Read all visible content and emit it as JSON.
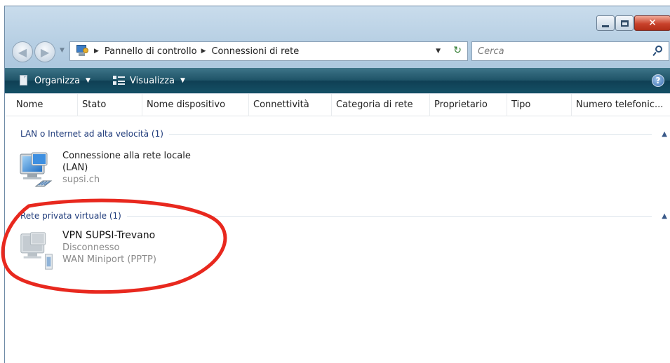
{
  "titlebar": {
    "buttons": [
      "minimize",
      "maximize",
      "close"
    ]
  },
  "address": {
    "root_label": "Pannello di controllo",
    "current_label": "Connessioni di rete"
  },
  "search": {
    "placeholder": "Cerca"
  },
  "toolbar": {
    "organize_label": "Organizza",
    "views_label": "Visualizza",
    "help_glyph": "?"
  },
  "columns": [
    "Nome",
    "Stato",
    "Nome dispositivo",
    "Connettività",
    "Categoria di rete",
    "Proprietario",
    "Tipo",
    "Numero telefonic..."
  ],
  "groups": [
    {
      "label": "LAN o Internet ad alta velocità (1)",
      "items": [
        {
          "name": "Connessione alla rete locale",
          "name_line2": "(LAN)",
          "subtitle": "supsi.ch",
          "icon": "lan-network-icon"
        }
      ]
    },
    {
      "label": "Rete privata virtuale (1)",
      "items": [
        {
          "name": "VPN SUPSI-Trevano",
          "status": "Disconnesso",
          "device": "WAN Miniport (PPTP)",
          "icon": "vpn-connection-icon"
        }
      ]
    }
  ],
  "colors": {
    "toolbar": "#1f5468",
    "group_header": "#1e3a7a",
    "annotation": "#e8281e"
  }
}
